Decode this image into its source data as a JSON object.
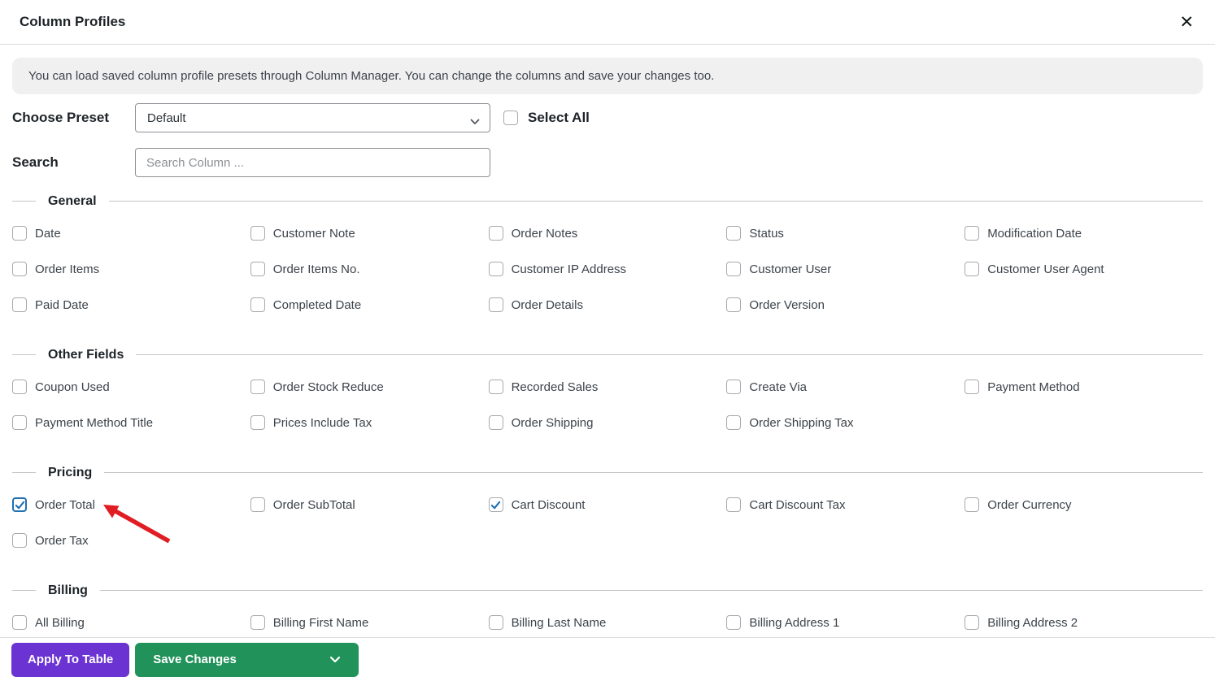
{
  "header": {
    "title": "Column Profiles",
    "close_icon": "✕"
  },
  "notice": {
    "text": "You can load saved column profile presets through Column Manager. You can change the columns and save your changes too."
  },
  "preset": {
    "label": "Choose Preset",
    "selected_option": "Default",
    "select_all": {
      "label": "Select All",
      "checked": false
    }
  },
  "search": {
    "label": "Search",
    "placeholder": "Search Column ..."
  },
  "sections": [
    {
      "title": "General",
      "items": [
        {
          "label": "Date",
          "checked": false
        },
        {
          "label": "Customer Note",
          "checked": false
        },
        {
          "label": "Order Notes",
          "checked": false
        },
        {
          "label": "Status",
          "checked": false
        },
        {
          "label": "Modification Date",
          "checked": false
        },
        {
          "label": "Order Items",
          "checked": false
        },
        {
          "label": "Order Items No.",
          "checked": false
        },
        {
          "label": "Customer IP Address",
          "checked": false
        },
        {
          "label": "Customer User",
          "checked": false
        },
        {
          "label": "Customer User Agent",
          "checked": false
        },
        {
          "label": "Paid Date",
          "checked": false
        },
        {
          "label": "Completed Date",
          "checked": false
        },
        {
          "label": "Order Details",
          "checked": false
        },
        {
          "label": "Order Version",
          "checked": false
        }
      ]
    },
    {
      "title": "Other Fields",
      "items": [
        {
          "label": "Coupon Used",
          "checked": false
        },
        {
          "label": "Order Stock Reduce",
          "checked": false
        },
        {
          "label": "Recorded Sales",
          "checked": false
        },
        {
          "label": "Create Via",
          "checked": false
        },
        {
          "label": "Payment Method",
          "checked": false
        },
        {
          "label": "Payment Method Title",
          "checked": false
        },
        {
          "label": "Prices Include Tax",
          "checked": false
        },
        {
          "label": "Order Shipping",
          "checked": false
        },
        {
          "label": "Order Shipping Tax",
          "checked": false
        }
      ]
    },
    {
      "title": "Pricing",
      "items": [
        {
          "label": "Order Total",
          "checked": true,
          "focus": true
        },
        {
          "label": "Order SubTotal",
          "checked": false
        },
        {
          "label": "Cart Discount",
          "checked": true
        },
        {
          "label": "Cart Discount Tax",
          "checked": false
        },
        {
          "label": "Order Currency",
          "checked": false
        },
        {
          "label": "Order Tax",
          "checked": false
        }
      ]
    },
    {
      "title": "Billing",
      "items": [
        {
          "label": "All Billing",
          "checked": false
        },
        {
          "label": "Billing First Name",
          "checked": false
        },
        {
          "label": "Billing Last Name",
          "checked": false
        },
        {
          "label": "Billing Address 1",
          "checked": false
        },
        {
          "label": "Billing Address 2",
          "checked": false
        }
      ]
    }
  ],
  "footer": {
    "apply_button": "Apply To Table",
    "save_button": "Save Changes"
  },
  "colors": {
    "check_blue": "#2271b1",
    "apply_purple": "#6b34d2",
    "save_green": "#21925a",
    "arrow_red": "#e11d24",
    "notice_bg": "#f0f0f1"
  }
}
